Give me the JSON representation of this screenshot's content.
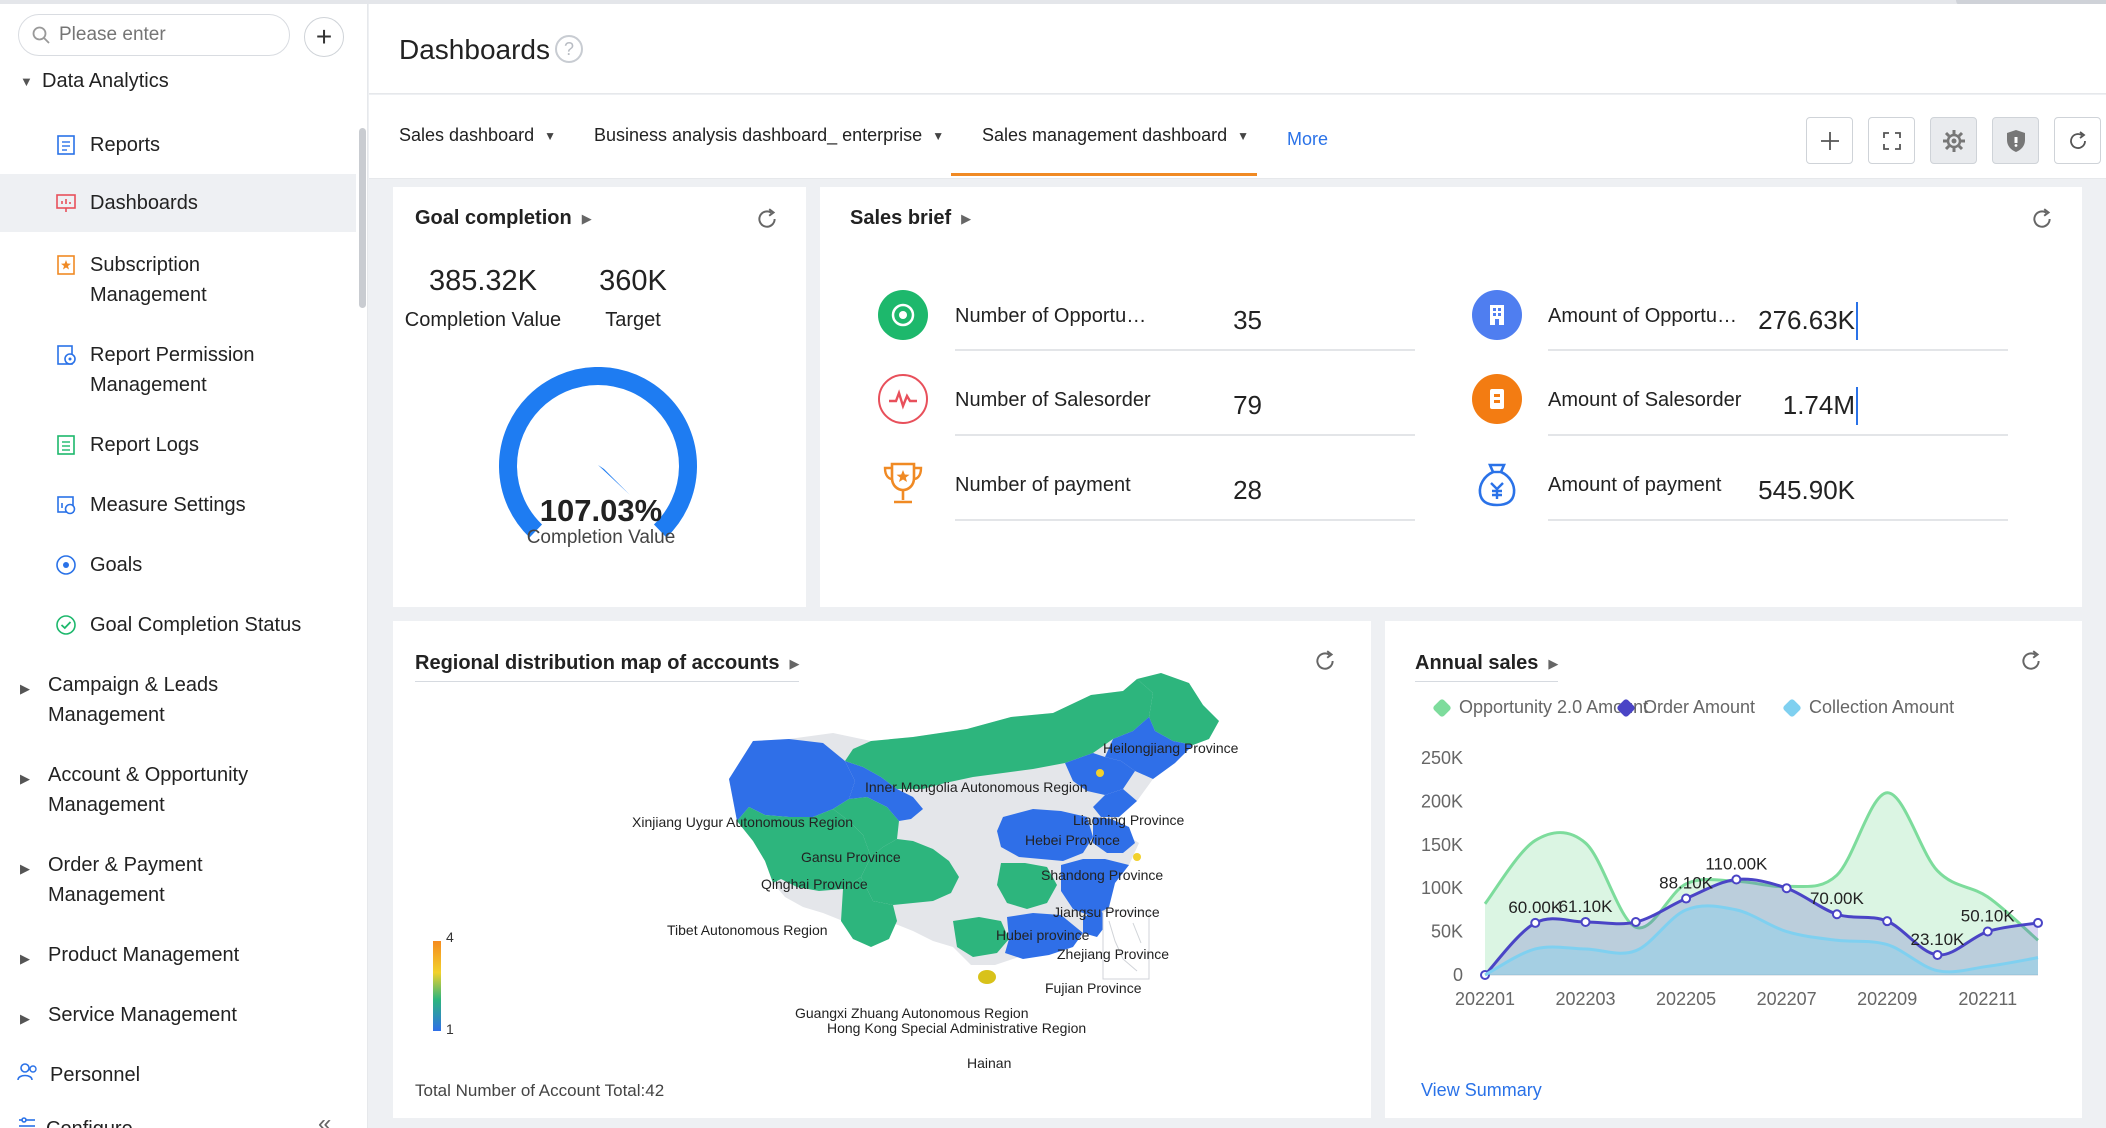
{
  "search": {
    "placeholder": "Please enter"
  },
  "sidebar": {
    "section_data_analytics": "Data Analytics",
    "items": [
      {
        "label": "Reports"
      },
      {
        "label": "Dashboards"
      },
      {
        "label": "Subscription Management"
      },
      {
        "label": "Report Permission Management"
      },
      {
        "label": "Report Logs"
      },
      {
        "label": "Measure Settings"
      },
      {
        "label": "Goals"
      },
      {
        "label": "Goal Completion Status"
      }
    ],
    "sections": [
      {
        "label": "Campaign & Leads Management"
      },
      {
        "label": "Account & Opportunity Management"
      },
      {
        "label": "Order & Payment Management"
      },
      {
        "label": "Product Management"
      },
      {
        "label": "Service Management"
      }
    ],
    "personnel": "Personnel",
    "configure": "Configure",
    "collapse_glyph": "«"
  },
  "header": {
    "title": "Dashboards",
    "help_glyph": "?"
  },
  "tabs": [
    {
      "label": "Sales dashboard"
    },
    {
      "label": "Business analysis dashboard_ enterprise"
    },
    {
      "label": "Sales management dashboard"
    }
  ],
  "more_label": "More",
  "goal_card": {
    "title": "Goal completion",
    "completion_value": "385.32K",
    "completion_label": "Completion Value",
    "target_value": "360K",
    "target_label": "Target",
    "gauge_percent": "107.03%",
    "gauge_label": "Completion Value",
    "gauge_fraction": 1.0703
  },
  "brief_card": {
    "title": "Sales brief",
    "rows": [
      {
        "label": "Number of Opportu…",
        "value": "35",
        "icon": "target-icon",
        "color": "#1db86c"
      },
      {
        "label": "Number of Salesorder",
        "value": "79",
        "icon": "pulse-icon",
        "color": "#e8505b"
      },
      {
        "label": "Number of payment",
        "value": "28",
        "icon": "trophy-icon",
        "color": "#f08a24"
      },
      {
        "label": "Amount of Opportu…",
        "value": "276.63K",
        "icon": "building-icon",
        "color": "#4f7ef0"
      },
      {
        "label": "Amount of Salesorder",
        "value": "1.74M",
        "icon": "document-icon",
        "color": "#f37c12"
      },
      {
        "label": "Amount of payment",
        "value": "545.90K",
        "icon": "money-bag-icon",
        "color": "#2a72e8"
      }
    ]
  },
  "map_card": {
    "title": "Regional distribution map of accounts",
    "footer": "Total Number of Account Total:42",
    "scale_max": "4",
    "scale_min": "1",
    "regions": [
      "Heilongjiang Province",
      "Inner Mongolia Autonomous Region",
      "Xinjiang Uygur Autonomous Region",
      "Liaoning Province",
      "Gansu Province",
      "Hebei Province",
      "Qinghai Province",
      "Shandong Province",
      "Jiangsu Province",
      "Tibet Autonomous Region",
      "Hubei province",
      "Zhejiang Province",
      "Fujian Province",
      "Guangxi Zhuang Autonomous Region",
      "Hong Kong Special Administrative Region",
      "Hainan"
    ]
  },
  "sales_card": {
    "title": "Annual sales",
    "view_summary": "View Summary",
    "colors": {
      "opportunity": "#7ddc9c",
      "order": "#4a44c6",
      "collection": "#7fd0f0"
    }
  },
  "chart_data": {
    "type": "area",
    "title": "Annual sales",
    "x": [
      "202201",
      "202202",
      "202203",
      "202204",
      "202205",
      "202206",
      "202207",
      "202208",
      "202209",
      "202210",
      "202211",
      "202212"
    ],
    "xticks": [
      "202201",
      "202203",
      "202205",
      "202207",
      "202209",
      "202211"
    ],
    "yticks": [
      "0",
      "50K",
      "100K",
      "150K",
      "200K",
      "250K"
    ],
    "ylim": [
      0,
      250000
    ],
    "legend_position": "top",
    "series": [
      {
        "name": "Opportunity 2.0 Amount",
        "values": [
          82000,
          155000,
          152000,
          55000,
          105000,
          108000,
          102000,
          115000,
          210000,
          120000,
          90000,
          40000
        ]
      },
      {
        "name": "Order Amount",
        "values": [
          0,
          60000,
          61100,
          61000,
          88100,
          110000,
          100000,
          70000,
          62000,
          23100,
          50100,
          60000
        ]
      },
      {
        "name": "Collection Amount",
        "values": [
          0,
          30000,
          30000,
          28000,
          75000,
          75000,
          50000,
          40000,
          35000,
          5000,
          10000,
          20000
        ]
      }
    ],
    "data_labels": [
      {
        "text": "60.00K",
        "series": "Order Amount",
        "x": "202202"
      },
      {
        "text": "61.10K",
        "series": "Order Amount",
        "x": "202203"
      },
      {
        "text": "88.10K",
        "series": "Order Amount",
        "x": "202205"
      },
      {
        "text": "110.00K",
        "series": "Order Amount",
        "x": "202206"
      },
      {
        "text": "70.00K",
        "series": "Order Amount",
        "x": "202208"
      },
      {
        "text": "23.10K",
        "series": "Order Amount",
        "x": "202210"
      },
      {
        "text": "50.10K",
        "series": "Order Amount",
        "x": "202211"
      }
    ]
  }
}
